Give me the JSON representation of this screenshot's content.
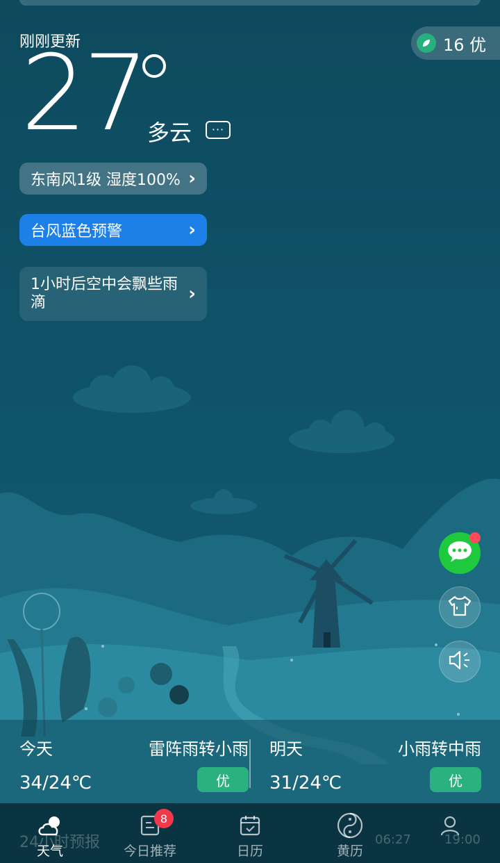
{
  "header": {
    "updated": "刚刚更新",
    "temperature": "27",
    "condition": "多云",
    "aqi": "16 优"
  },
  "info_pills": {
    "wind": "东南风1级  湿度100%",
    "alert": "台风蓝色预警",
    "rain": "1小时后空中会飘些雨滴"
  },
  "forecast": {
    "today": {
      "day": "今天",
      "condition": "雷阵雨转小雨",
      "range": "34/24℃",
      "aqi": "优"
    },
    "tomorrow": {
      "day": "明天",
      "condition": "小雨转中雨",
      "range": "31/24℃",
      "aqi": "优"
    }
  },
  "side_buttons": [
    "chat-icon",
    "shirt-icon",
    "speaker-icon"
  ],
  "tabbar": {
    "items": [
      {
        "label": "天气",
        "icon": "weather-icon"
      },
      {
        "label": "今日推荐",
        "icon": "news-icon",
        "badge": "8"
      },
      {
        "label": "日历",
        "icon": "calendar-icon"
      },
      {
        "label": "黄历",
        "icon": "almanac-icon"
      },
      {
        "label": "",
        "icon": "profile-icon"
      }
    ],
    "ghost_text": {
      "hourly": "24小时预报",
      "sunrise": "06:27",
      "sunset": "19:00"
    }
  },
  "colors": {
    "accent": "#1d7fe8",
    "aqi_green": "#2bb080",
    "chat_green": "#1fc93e"
  }
}
